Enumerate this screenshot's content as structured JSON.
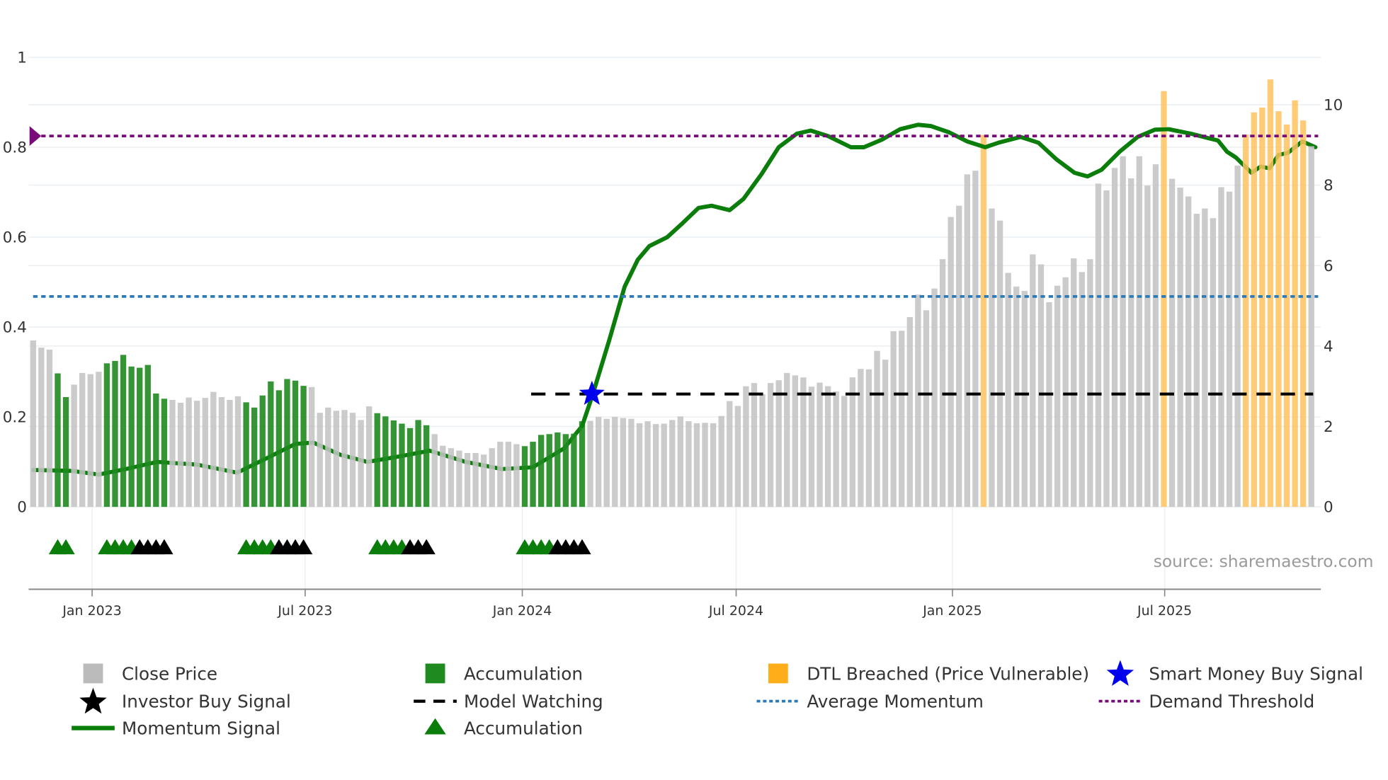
{
  "chart_data": {
    "type": "bar",
    "title": "",
    "source": "source: sharemaestro.com",
    "x_unit": "week index",
    "x_ticks": [
      {
        "label": "Jan 2023",
        "week": 8.2
      },
      {
        "label": "Jul 2023",
        "week": 34.2
      },
      {
        "label": "Jan 2024",
        "week": 60.7
      },
      {
        "label": "Jul 2024",
        "week": 86.8
      },
      {
        "label": "Jan 2025",
        "week": 113.2
      },
      {
        "label": "Jul 2025",
        "week": 139.1
      }
    ],
    "y_left": {
      "range": [
        0,
        1
      ],
      "ticks": [
        "0",
        "0.2",
        "0.4",
        "0.6",
        "0.8",
        "1"
      ],
      "tick_values": [
        0,
        0.2,
        0.4,
        0.6,
        0.8,
        1
      ]
    },
    "y_right": {
      "range": [
        0,
        11.2
      ],
      "ticks": [
        "0",
        "2",
        "4",
        "6",
        "8",
        "10"
      ],
      "tick_values": [
        0,
        2,
        4,
        6,
        8,
        10
      ]
    },
    "close_price": [
      4.14,
      3.96,
      3.91,
      3.32,
      2.73,
      3.04,
      3.33,
      3.3,
      3.36,
      3.57,
      3.63,
      3.78,
      3.49,
      3.46,
      3.53,
      2.82,
      2.69,
      2.66,
      2.59,
      2.72,
      2.64,
      2.71,
      2.86,
      2.73,
      2.66,
      2.75,
      2.6,
      2.47,
      2.77,
      3.12,
      2.9,
      3.18,
      3.14,
      3.01,
      2.98,
      2.34,
      2.47,
      2.39,
      2.41,
      2.34,
      2.16,
      2.5,
      2.33,
      2.25,
      2.15,
      2.07,
      1.96,
      2.16,
      2.03,
      1.81,
      1.52,
      1.46,
      1.4,
      1.34,
      1.34,
      1.3,
      1.46,
      1.62,
      1.62,
      1.56,
      1.51,
      1.62,
      1.79,
      1.81,
      1.85,
      1.81,
      1.82,
      2.13,
      2.14,
      2.24,
      2.19,
      2.24,
      2.21,
      2.19,
      2.08,
      2.13,
      2.06,
      2.07,
      2.16,
      2.25,
      2.13,
      2.08,
      2.09,
      2.08,
      2.26,
      2.63,
      2.51,
      3.0,
      3.08,
      2.8,
      3.08,
      3.15,
      3.33,
      3.27,
      3.22,
      2.99,
      3.09,
      3.0,
      2.87,
      2.76,
      3.22,
      3.43,
      3.42,
      3.88,
      3.66,
      4.37,
      4.38,
      4.72,
      5.28,
      4.89,
      5.43,
      6.16,
      7.21,
      7.49,
      8.27,
      8.36,
      9.25,
      7.42,
      7.12,
      5.82,
      5.48,
      5.37,
      6.28,
      6.03,
      5.09,
      5.5,
      5.71,
      6.18,
      5.84,
      6.16,
      8.04,
      7.87,
      8.43,
      8.72,
      8.17,
      8.72,
      7.99,
      8.52,
      10.34,
      8.16,
      7.94,
      7.72,
      7.29,
      7.42,
      7.18,
      7.95,
      7.84,
      8.49,
      9.26,
      9.81,
      9.93,
      10.63,
      9.84,
      9.51,
      10.11,
      9.61,
      8.97
    ],
    "accumulation_weeks": [
      4,
      5,
      10,
      11,
      12,
      13,
      14,
      15,
      16,
      17,
      27,
      28,
      29,
      30,
      31,
      32,
      33,
      34,
      43,
      44,
      45,
      46,
      47,
      48,
      49,
      61,
      62,
      63,
      64,
      65,
      66,
      67,
      68
    ],
    "dtl_breached_weeks": [
      117,
      139,
      149,
      150,
      151,
      152,
      153,
      154,
      155,
      156
    ],
    "momentum_signal": [
      [
        1,
        0.082
      ],
      [
        5.7,
        0.08
      ],
      [
        9,
        0.072
      ],
      [
        12.3,
        0.084
      ],
      [
        16.1,
        0.1
      ],
      [
        21,
        0.094
      ],
      [
        25.9,
        0.076
      ],
      [
        29.7,
        0.11
      ],
      [
        33,
        0.14
      ],
      [
        35.2,
        0.143
      ],
      [
        38.5,
        0.116
      ],
      [
        41.8,
        0.1
      ],
      [
        45,
        0.11
      ],
      [
        49.4,
        0.125
      ],
      [
        53.8,
        0.1
      ],
      [
        58.2,
        0.084
      ],
      [
        62,
        0.088
      ],
      [
        65.8,
        0.13
      ],
      [
        68,
        0.18
      ],
      [
        69.3,
        0.25
      ],
      [
        71.3,
        0.37
      ],
      [
        73.2,
        0.49
      ],
      [
        74.8,
        0.55
      ],
      [
        76.2,
        0.58
      ],
      [
        78.4,
        0.6
      ],
      [
        80.2,
        0.63
      ],
      [
        82.2,
        0.665
      ],
      [
        83.8,
        0.67
      ],
      [
        86,
        0.66
      ],
      [
        87.7,
        0.685
      ],
      [
        89.9,
        0.74
      ],
      [
        92,
        0.8
      ],
      [
        94.2,
        0.83
      ],
      [
        95.9,
        0.837
      ],
      [
        98,
        0.825
      ],
      [
        100.8,
        0.8
      ],
      [
        102.4,
        0.8
      ],
      [
        104.6,
        0.817
      ],
      [
        106.8,
        0.84
      ],
      [
        109,
        0.85
      ],
      [
        110.6,
        0.847
      ],
      [
        112.8,
        0.833
      ],
      [
        115,
        0.813
      ],
      [
        117.2,
        0.8
      ],
      [
        118.8,
        0.81
      ],
      [
        121.5,
        0.823
      ],
      [
        123.7,
        0.81
      ],
      [
        125.9,
        0.773
      ],
      [
        128.1,
        0.743
      ],
      [
        129.7,
        0.735
      ],
      [
        131.4,
        0.75
      ],
      [
        133.6,
        0.79
      ],
      [
        135.8,
        0.823
      ],
      [
        137.9,
        0.839
      ],
      [
        139.6,
        0.84
      ],
      [
        142.3,
        0.83
      ],
      [
        144.5,
        0.82
      ],
      [
        145.6,
        0.815
      ],
      [
        146.7,
        0.79
      ],
      [
        147.8,
        0.777
      ],
      [
        149.7,
        0.743
      ],
      [
        150.8,
        0.757
      ],
      [
        151.9,
        0.753
      ],
      [
        153,
        0.783
      ],
      [
        154.1,
        0.787
      ],
      [
        155.9,
        0.813
      ],
      [
        157.5,
        0.8
      ]
    ],
    "average_momentum": 0.468,
    "demand_threshold": 0.825,
    "model_watching": {
      "level": 0.251,
      "start_week": 62,
      "end_week": 157
    },
    "smart_money_buy_signal": {
      "week": 69.2,
      "value": 0.251
    },
    "accumulation_triangles_green": [
      4,
      5,
      10,
      11,
      12,
      13,
      27,
      28,
      29,
      30,
      43,
      44,
      45,
      46,
      61,
      62,
      63,
      64
    ],
    "investor_buy_triangles_black": [
      14,
      15,
      16,
      17,
      31,
      32,
      33,
      34,
      47,
      48,
      49,
      65,
      66,
      67,
      68
    ],
    "legend_placement": "bottom",
    "legend": [
      {
        "label": "Close Price",
        "icon": "gray-square-icon"
      },
      {
        "label": "Accumulation",
        "icon": "green-square-icon"
      },
      {
        "label": "DTL Breached (Price Vulnerable)",
        "icon": "orange-square-icon"
      },
      {
        "label": "Smart Money Buy Signal",
        "icon": "blue-star-icon"
      },
      {
        "label": "Investor Buy Signal",
        "icon": "black-star-icon"
      },
      {
        "label": "Model Watching",
        "icon": "black-dashed-line-icon"
      },
      {
        "label": "Average Momentum",
        "icon": "blue-dotted-line-icon"
      },
      {
        "label": "Demand Threshold",
        "icon": "purple-dotted-line-icon"
      },
      {
        "label": "Momentum Signal",
        "icon": "green-line-icon"
      },
      {
        "label": "Accumulation",
        "icon": "green-triangle-icon"
      }
    ],
    "colors": {
      "close_price": "#c4c4c4",
      "accumulation": "#1f8a1f",
      "dtl_breached": "#ffc25e",
      "momentum": "#0a7d0a",
      "average_momentum": "#2b7bb9",
      "demand_threshold": "#7a0a7a",
      "smart_money": "#0000ee",
      "investor": "#000000",
      "legend_gray": "#bbbbbb",
      "legend_orange": "#ffae1a"
    }
  }
}
